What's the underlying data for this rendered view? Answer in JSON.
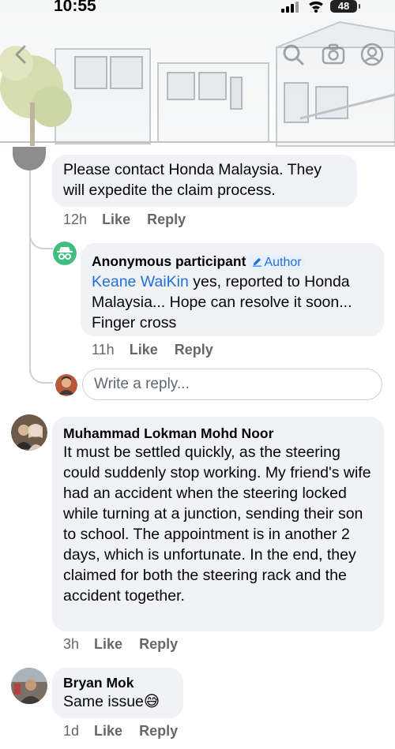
{
  "status": {
    "time": "10:55",
    "battery": "48"
  },
  "header_icons": [
    "back-icon",
    "search-icon",
    "camera-icon",
    "profile-icon"
  ],
  "comments": [
    {
      "text": "Please contact Honda Malaysia. They will expedite the claim process.",
      "time": "12h",
      "like": "Like",
      "reply": "Reply"
    },
    {
      "author": "Anonymous participant",
      "badge": "Author",
      "mention": "Keane WaiKin",
      "text": " yes, reported to Honda Malaysia... Hope can resolve it soon... Finger cross",
      "time": "11h",
      "like": "Like",
      "reply": "Reply"
    },
    {
      "author": "Muhammad Lokman Mohd Noor",
      "text": "It must be settled quickly, as the steering could suddenly stop working. My friend's wife had an accident when the steering locked while turning at a junction, sending their son to school. The appointment is in another 2 days, which is unfortunate. In the end, they claimed for both the steering rack and the accident together.",
      "time": "3h",
      "like": "Like",
      "reply": "Reply"
    },
    {
      "author": "Bryan Mok",
      "text": "Same issue",
      "emoji": "😅",
      "time": "1d",
      "like": "Like",
      "reply": "Reply"
    }
  ],
  "reply_box": {
    "placeholder": "Write a reply..."
  },
  "colors": {
    "bubble": "#f0f2f5",
    "link": "#216fdb",
    "meta": "#65676b",
    "anon_avatar": "#3fbf7f"
  }
}
